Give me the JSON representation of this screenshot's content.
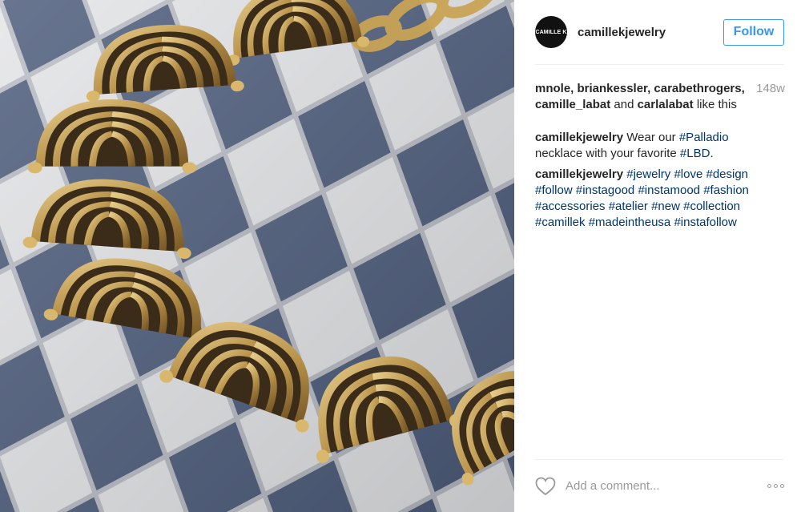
{
  "post": {
    "image_alt": "Gold shell-link necklace on a checkerboard",
    "header": {
      "avatar_text": "CAMILLE K",
      "username": "camillekjewelry",
      "follow_label": "Follow"
    },
    "likes": {
      "names_line1": "mnole, briankessler, carabethrogers,",
      "name_camille": "camille_labat",
      "and_text": "and",
      "name_carla": "carlalabat",
      "like_this": "like this",
      "time": "148w"
    },
    "caption": {
      "author": "camillekjewelry",
      "text_wear": "Wear our",
      "tag_palladio": "#Palladio",
      "text_necklace": "necklace with your favorite",
      "tag_lbd": "#LBD",
      "period": "."
    },
    "hashtags_comment": {
      "author": "camillekjewelry",
      "tags": [
        "#jewelry",
        "#love",
        "#design",
        "#follow",
        "#instagood",
        "#instamood",
        "#fashion",
        "#accessories",
        "#atelier",
        "#new",
        "#collection",
        "#camillek",
        "#madeintheusa",
        "#instafollow"
      ]
    },
    "comment_box": {
      "placeholder": "Add a comment..."
    },
    "icons": {
      "like": "heart-outline-icon",
      "more": "more-options-icon"
    },
    "colors": {
      "link_blue": "#003569",
      "follow_blue": "#3897f0",
      "muted_gray": "#999999",
      "text": "#262626",
      "gold": "#b8924a",
      "tile_dark": "#4a5a78",
      "tile_light": "#e6e6e8"
    }
  }
}
